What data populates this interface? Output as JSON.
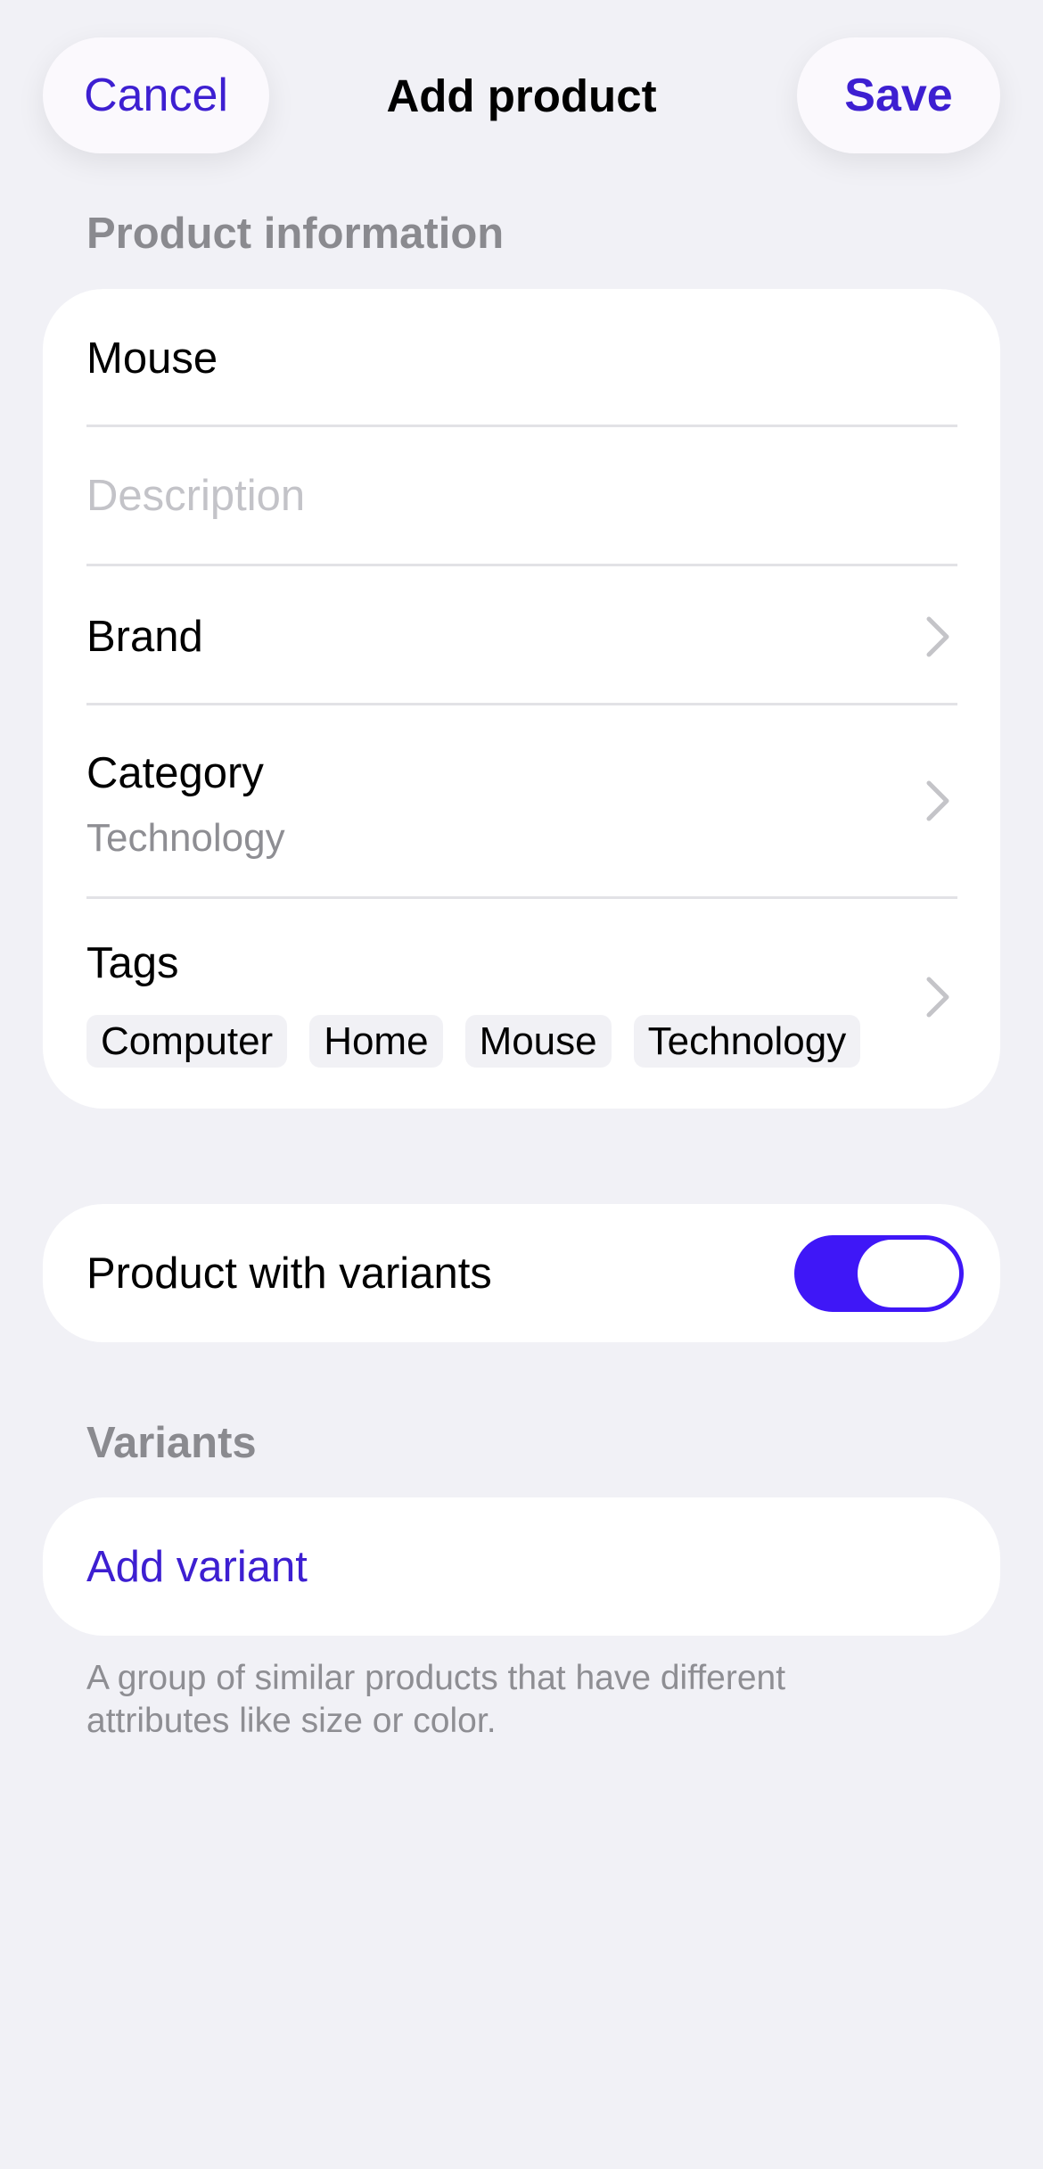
{
  "header": {
    "cancel_label": "Cancel",
    "title": "Add product",
    "save_label": "Save"
  },
  "product_info": {
    "section_title": "Product information",
    "name_value": "Mouse",
    "description_placeholder": "Description",
    "brand_label": "Brand",
    "category_label": "Category",
    "category_value": "Technology",
    "tags_label": "Tags",
    "tags": [
      "Computer",
      "Home",
      "Mouse",
      "Technology"
    ]
  },
  "variants_toggle": {
    "label": "Product with variants",
    "on": true
  },
  "variants": {
    "section_title": "Variants",
    "add_label": "Add variant",
    "footnote": "A group of similar products that have different attributes like size or color."
  },
  "icons": {
    "chevron": "chevron-right-icon"
  },
  "colors": {
    "accent": "#3d1fd1",
    "toggle_on": "#3f17f7",
    "background": "#f1f1f6",
    "secondary_text": "#8e8e93"
  }
}
